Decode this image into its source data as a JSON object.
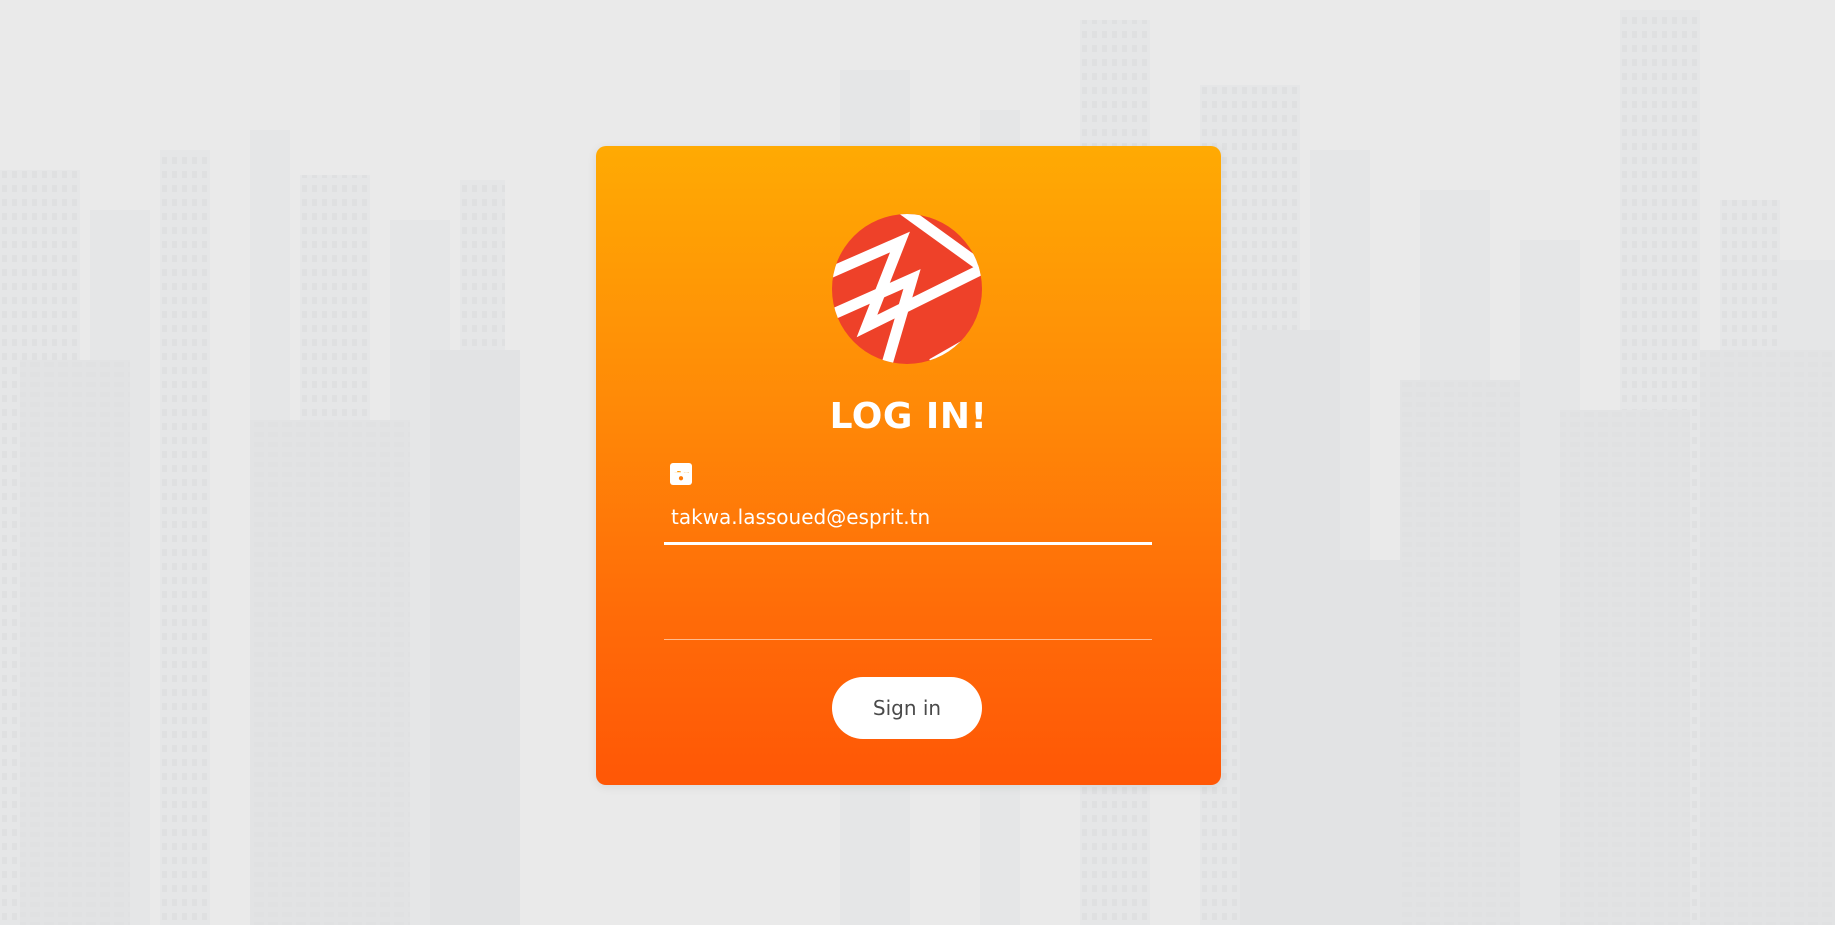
{
  "login": {
    "title": "LOG IN!",
    "email_value": "takwa.lassoued@esprit.tn",
    "password_value": "",
    "signin_label": "Sign in"
  },
  "icons": {
    "email": "google-plus-icon",
    "password": "lock-icon",
    "logo": "striped-circle-logo"
  },
  "colors": {
    "card_top": "#ffaa03",
    "card_bottom": "#ff5706",
    "logo_red": "#ee4129",
    "background": "#e9eaea"
  }
}
